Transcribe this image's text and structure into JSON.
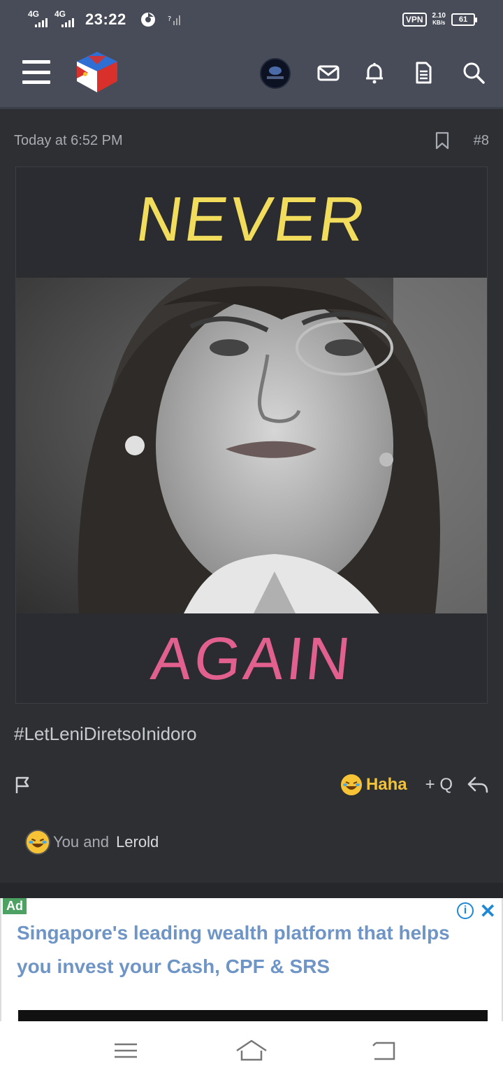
{
  "status_bar": {
    "network_1": "4G",
    "network_2": "4G",
    "time": "23:22",
    "vpn": "VPN",
    "speed_value": "2.10",
    "speed_unit": "KB/s",
    "battery": "61"
  },
  "app_bar": {
    "icons": [
      "menu-icon",
      "site-logo",
      "user-avatar",
      "mail-icon",
      "bell-icon",
      "document-icon",
      "search-icon"
    ]
  },
  "post": {
    "timestamp": "Today at 6:52 PM",
    "number": "#8",
    "image_text_top": "NEVER",
    "image_text_bottom": "AGAIN",
    "hashtag": "#LetLeniDiretsoInidoro",
    "reaction_label": "Haha",
    "quote_label": "+ Q",
    "reacted_prefix": "You and ",
    "reacted_name": "Lerold"
  },
  "ad": {
    "tag": "Ad",
    "info": "i",
    "close": "✕",
    "headline": "Singapore's leading wealth platform that helps you invest your Cash, CPF & SRS"
  },
  "colors": {
    "header_bg": "#474c58",
    "page_bg": "#2e2f33",
    "haha": "#f0c23b",
    "ad_text": "#6e95c6",
    "meme_top_text": "#f2dc5c",
    "meme_bottom_text": "#e2608d"
  }
}
